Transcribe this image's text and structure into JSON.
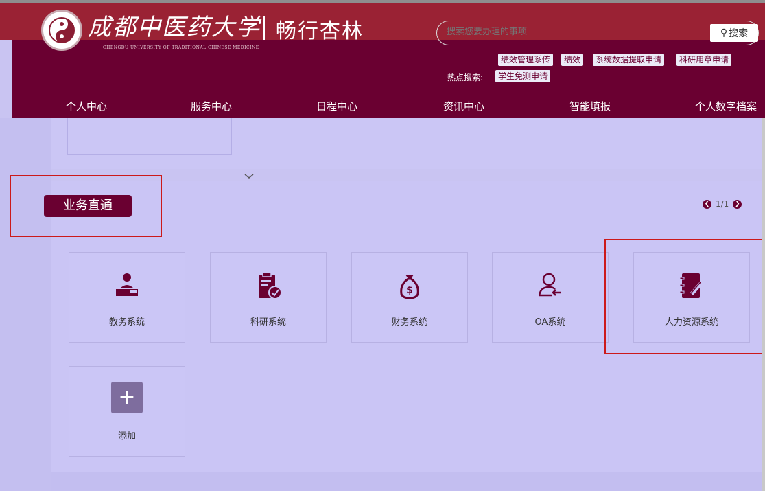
{
  "header": {
    "logo_text": "成都中医药大学",
    "logo_sub": "畅行杏林",
    "logo_en": "CHENGDU UNIVERSITY OF TRADITIONAL CHINESE MEDICINE",
    "search_placeholder": "搜索您要办理的事项",
    "search_button": "搜索",
    "hot_label": "热点搜索:",
    "hot_tags": [
      "绩效管理系传",
      "绩效",
      "系统数据提取申请",
      "科研用章申请",
      "学生免测申请"
    ]
  },
  "nav": [
    "个人中心",
    "服务中心",
    "日程中心",
    "资讯中心",
    "智能填报",
    "个人数字档案"
  ],
  "section": {
    "title": "业务直通",
    "pager": "1/1"
  },
  "tiles": [
    {
      "label": "教务系统",
      "icon": "teacher-icon"
    },
    {
      "label": "科研系统",
      "icon": "clipboard-check-icon"
    },
    {
      "label": "财务系统",
      "icon": "money-bag-icon"
    },
    {
      "label": "OA系统",
      "icon": "user-arrow-icon"
    },
    {
      "label": "人力资源系统",
      "icon": "notebook-pen-icon"
    },
    {
      "label": "添加",
      "icon": "add-icon"
    }
  ],
  "colors": {
    "brand": "#6a0031",
    "header_top": "#9a2234",
    "background": "#c9c4f2",
    "highlight": "#cc1a1a"
  }
}
